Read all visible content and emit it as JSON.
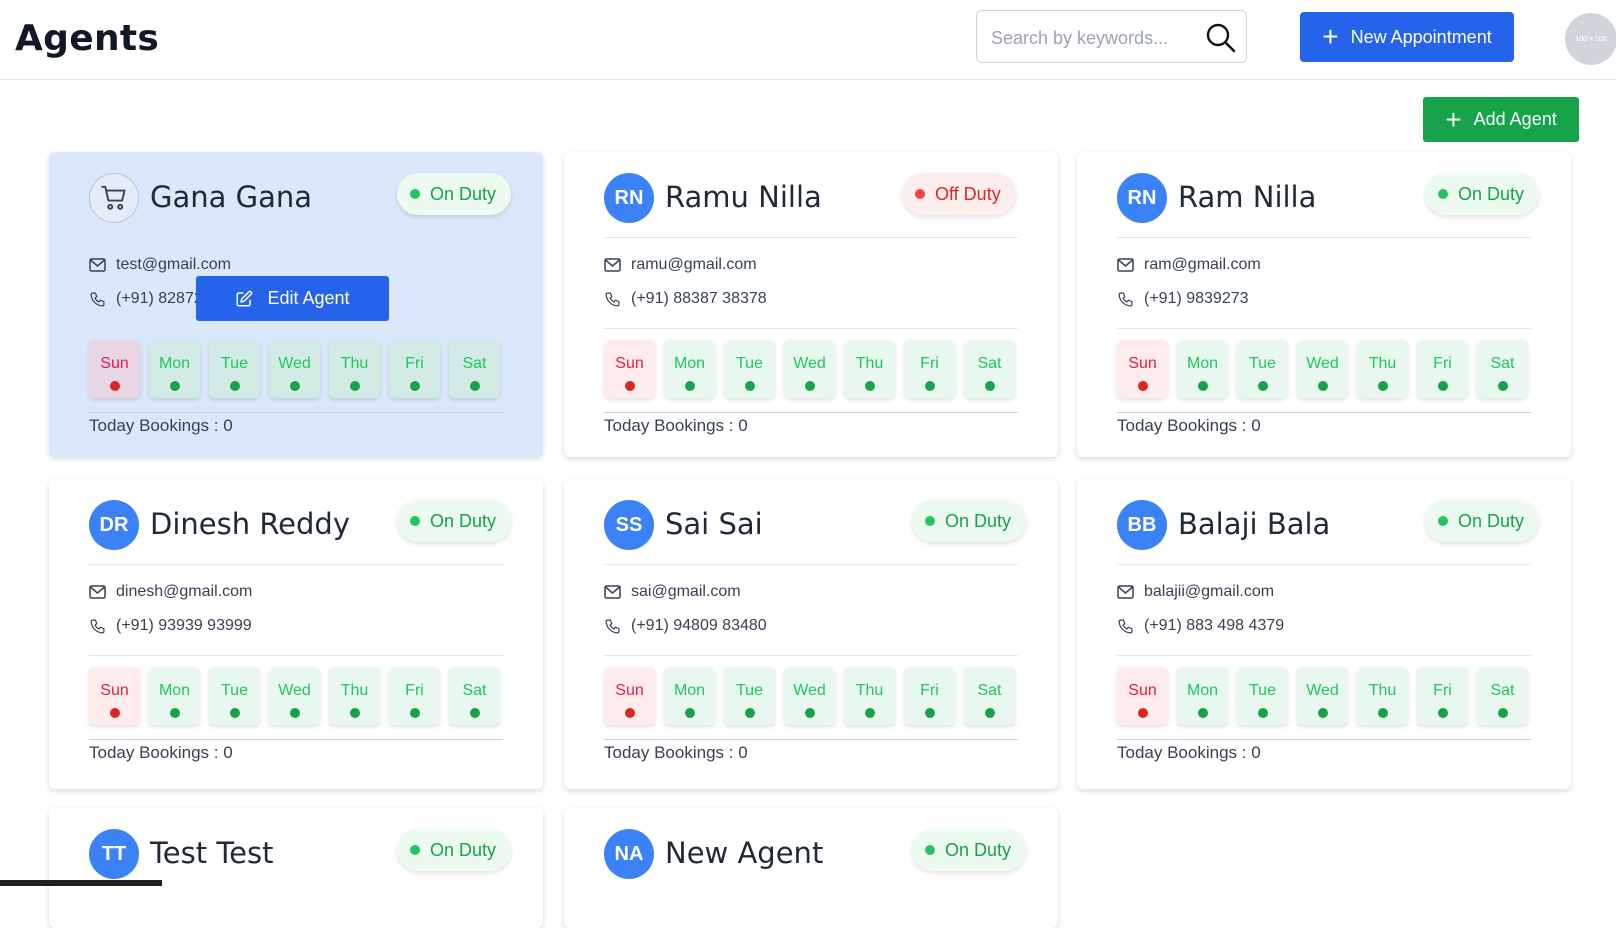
{
  "header": {
    "title": "Agents",
    "search_placeholder": "Search by keywords...",
    "new_appointment_label": "New Appointment",
    "avatar_text": "100 × 100"
  },
  "add_agent_label": "Add Agent",
  "edit_agent_label": "Edit Agent",
  "day_labels": [
    "Sun",
    "Mon",
    "Tue",
    "Wed",
    "Thu",
    "Fri",
    "Sat"
  ],
  "colors": {
    "primary": "#2563eb",
    "green": "#16a34a",
    "on": "#22c55e",
    "off": "#dc2626"
  },
  "agents": [
    {
      "initials": "",
      "icon": "cart-icon",
      "name": "Gana Gana",
      "status": "On Duty",
      "email": "test@gmail.com",
      "phone": "(+91) 82872",
      "days_on": [
        false,
        true,
        true,
        true,
        true,
        true,
        true
      ],
      "bookings": "Today Bookings : 0",
      "highlighted": true
    },
    {
      "initials": "RN",
      "name": "Ramu Nilla",
      "status": "Off Duty",
      "email": "ramu@gmail.com",
      "phone": "(+91) 88387 38378",
      "days_on": [
        false,
        true,
        true,
        true,
        true,
        true,
        true
      ],
      "bookings": "Today Bookings : 0"
    },
    {
      "initials": "RN",
      "name": "Ram Nilla",
      "status": "On Duty",
      "email": "ram@gmail.com",
      "phone": "(+91) 9839273",
      "days_on": [
        false,
        true,
        true,
        true,
        true,
        true,
        true
      ],
      "bookings": "Today Bookings : 0"
    },
    {
      "initials": "DR",
      "name": "Dinesh Reddy",
      "status": "On Duty",
      "email": "dinesh@gmail.com",
      "phone": "(+91) 93939 93999",
      "days_on": [
        false,
        true,
        true,
        true,
        true,
        true,
        true
      ],
      "bookings": "Today Bookings : 0"
    },
    {
      "initials": "SS",
      "name": "Sai Sai",
      "status": "On Duty",
      "email": "sai@gmail.com",
      "phone": "(+91) 94809 83480",
      "days_on": [
        false,
        true,
        true,
        true,
        true,
        true,
        true
      ],
      "bookings": "Today Bookings : 0"
    },
    {
      "initials": "BB",
      "name": "Balaji Bala",
      "status": "On Duty",
      "email": "balajii@gmail.com",
      "phone": "(+91) 883 498 4379",
      "days_on": [
        false,
        true,
        true,
        true,
        true,
        true,
        true
      ],
      "bookings": "Today Bookings : 0"
    },
    {
      "initials": "TT",
      "name": "Test Test",
      "status": "On Duty"
    },
    {
      "initials": "NA",
      "name": "New Agent",
      "status": "On Duty"
    }
  ]
}
